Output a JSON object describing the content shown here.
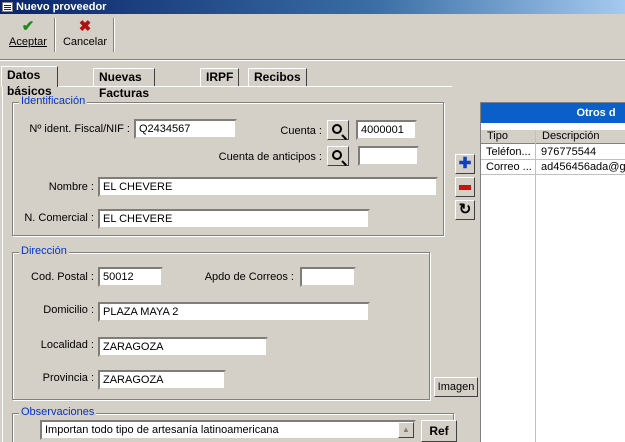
{
  "window": {
    "title": "Nuevo proveedor"
  },
  "toolbar": {
    "accept_label": "Aceptar",
    "cancel_label": "Cancelar"
  },
  "tabs": [
    {
      "label": "Datos básicos",
      "active": true
    },
    {
      "label": "Nuevas Facturas"
    },
    {
      "label": "IRPF"
    },
    {
      "label": "Recibos"
    }
  ],
  "identificacion": {
    "title": "Identificación",
    "nif_label": "Nº ident. Fiscal/NIF :",
    "nif_value": "Q2434567",
    "cuenta_label": "Cuenta :",
    "cuenta_value": "4000001",
    "anticipos_label": "Cuenta de anticipos :",
    "anticipos_value": "",
    "nombre_label": "Nombre :",
    "nombre_value": "EL CHEVERE",
    "comercial_label": "N. Comercial :",
    "comercial_value": "EL CHEVERE"
  },
  "direccion": {
    "title": "Dirección",
    "cp_label": "Cod. Postal :",
    "cp_value": "50012",
    "apdo_label": "Apdo de Correos :",
    "apdo_value": "",
    "domicilio_label": "Domicilio :",
    "domicilio_value": "PLAZA MAYA 2",
    "localidad_label": "Localidad :",
    "localidad_value": "ZARAGOZA",
    "provincia_label": "Provincia :",
    "provincia_value": "ZARAGOZA"
  },
  "imagen_button_label": "Imagen",
  "observaciones": {
    "title": "Observaciones",
    "value": "Importan todo tipo de artesanía latinoamericana",
    "ref_button_label": "Ref"
  },
  "otros_datos": {
    "header": "Otros d",
    "columns": [
      "Tipo",
      "Descripción"
    ],
    "rows": [
      {
        "tipo": "Teléfon...",
        "descripcion": "976775544"
      },
      {
        "tipo": "Correo ...",
        "descripcion": "ad456456ada@g"
      }
    ]
  },
  "icons": {
    "accept": "check-icon",
    "cancel": "x-icon",
    "search": "magnifier-icon",
    "add": "plus-icon",
    "remove": "minus-icon",
    "refresh": "refresh-icon"
  }
}
